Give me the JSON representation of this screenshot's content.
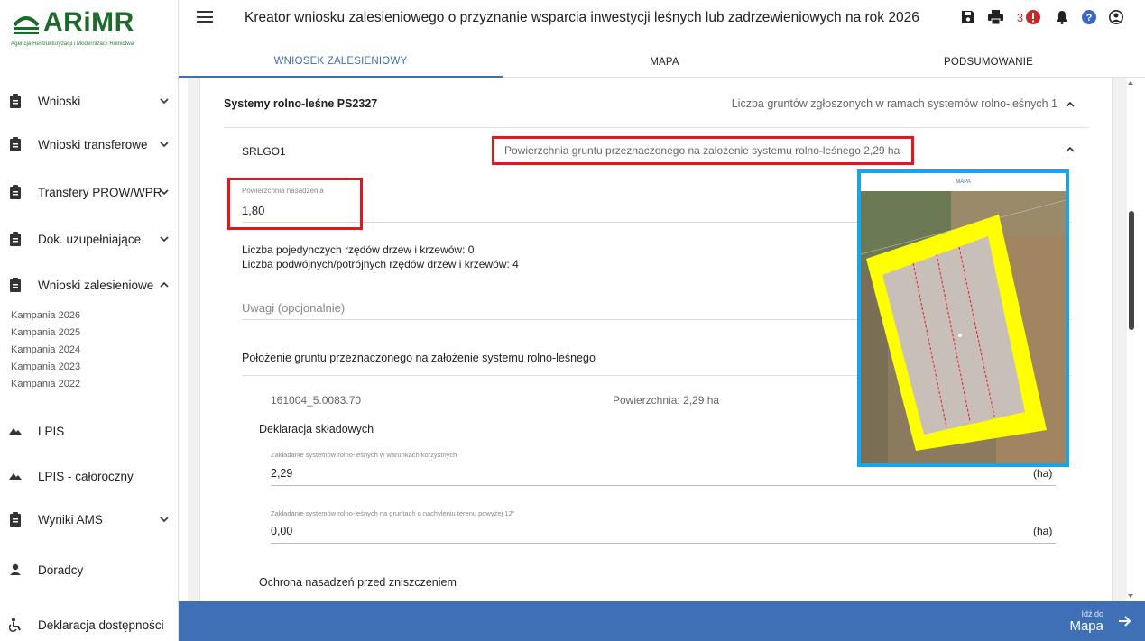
{
  "logo": {
    "name": "ARiMR",
    "subtitle": "Agencja Restrukturyzacji i Modernizacji Rolnictwa"
  },
  "sidebar": {
    "items": [
      {
        "label": "Wnioski",
        "icon": "clipboard-icon",
        "chevron": "down"
      },
      {
        "label": "Wnioski transferowe",
        "icon": "clipboard-icon",
        "chevron": "down"
      },
      {
        "label": "Transfery PROW/WPR",
        "icon": "clipboard-icon",
        "chevron": "down"
      },
      {
        "label": "Dok. uzupełniające",
        "icon": "clipboard-icon",
        "chevron": "down"
      },
      {
        "label": "Wnioski zalesieniowe",
        "icon": "clipboard-icon",
        "chevron": "up"
      },
      {
        "label": "LPIS",
        "icon": "terrain-icon"
      },
      {
        "label": "LPIS - całoroczny",
        "icon": "terrain-icon"
      },
      {
        "label": "Wyniki AMS",
        "icon": "clipboard-icon",
        "chevron": "down"
      },
      {
        "label": "Doradcy",
        "icon": "person-icon"
      },
      {
        "label": "Deklaracja dostępności",
        "icon": "accessibility-icon"
      }
    ],
    "sub_items": [
      "Kampania 2026",
      "Kampania 2025",
      "Kampania 2024",
      "Kampania 2023",
      "Kampania 2022"
    ]
  },
  "header": {
    "title": "Kreator wniosku zalesieniowego o przyznanie wsparcia inwestycji leśnych lub zadrzewieniowych na rok 2026",
    "error_count": "3",
    "tabs": [
      "WNIOSEK ZALESIENIOWY",
      "MAPA",
      "PODSUMOWANIE"
    ]
  },
  "section": {
    "title": "Systemy rolno-leśne PS2327",
    "summary": "Liczba gruntów zgłoszonych w ramach systemów rolno-leśnych 1",
    "item_id": "SRLGO1",
    "item_area": "Powierzchnia gruntu przeznaczonego na założenie systemu rolno-leśnego 2,29 ha",
    "planting_area_label": "Powierzchnia nasadzenia",
    "planting_area_value": "1,80",
    "single_rows": "Liczba pojedynczych rzędów drzew i krzewów: 0",
    "double_rows": "Liczba podwójnych/potrójnych rzędów drzew i krzewów: 4",
    "notes_placeholder": "Uwagi (opcjonalnie)",
    "location_heading": "Położenie gruntu przeznaczonego na założenie systemu rolno-leśnego",
    "parcel_id": "161004_5.0083.70",
    "parcel_area": "Powierzchnia: 2,29 ha",
    "declaration_heading": "Deklaracja składowych",
    "field1_label": "Zakładanie systemów rolno-leśnych w warunkach korzystnych",
    "field1_value": "2,29",
    "field2_label": "Zakładanie systemów rolno-leśnych na gruntach o nachyleniu terenu powyżej 12°",
    "field2_value": "0,00",
    "unit": "(ha)",
    "protection_heading": "Ochrona nasadzeń przed zniszczeniem"
  },
  "map_popup": {
    "title": "MAPA"
  },
  "footer": {
    "go_to": "Idź do",
    "target": "Mapa"
  },
  "colors": {
    "accent": "#3f6fb5",
    "highlight_red": "#e8141c",
    "highlight_blue": "#1aa3e6",
    "parcel_yellow": "#ffff00"
  }
}
